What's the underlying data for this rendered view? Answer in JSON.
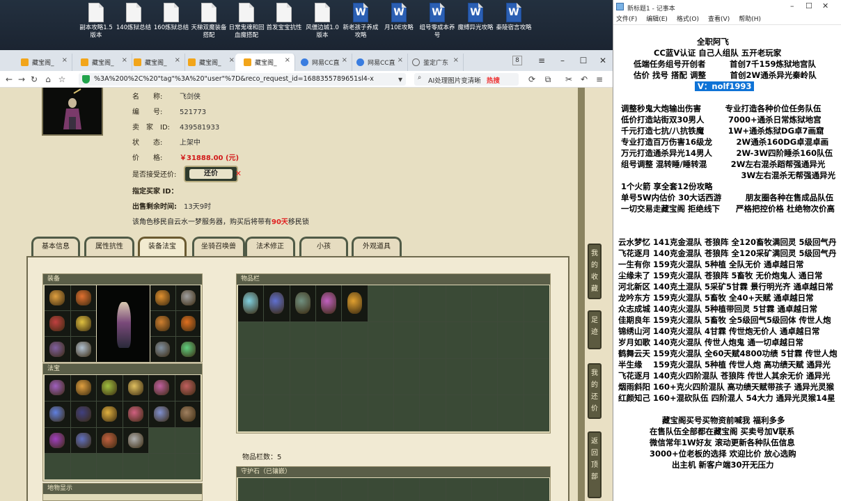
{
  "desktop": {
    "icons": [
      {
        "label": "副本攻略1.5版本",
        "type": "doc"
      },
      {
        "label": "140炼狱总结",
        "type": "doc"
      },
      {
        "label": "160炼狱总结",
        "type": "doc"
      },
      {
        "label": "天梯双魔装备搭配",
        "type": "doc"
      },
      {
        "label": "日常鬼魂和回血魔搭配",
        "type": "doc"
      },
      {
        "label": "首发宝宝抗性",
        "type": "doc"
      },
      {
        "label": "风僵边城1.0版本",
        "type": "doc"
      },
      {
        "label": "新老孩子养成攻略",
        "type": "word"
      },
      {
        "label": "月10E攻略",
        "type": "word"
      },
      {
        "label": "组号零成本养号",
        "type": "word"
      },
      {
        "label": "魔缚异光攻略",
        "type": "word"
      },
      {
        "label": "秦陵宿言攻略",
        "type": "word"
      }
    ]
  },
  "browser": {
    "tabs": [
      {
        "label": "藏宝阁_",
        "icon": "treasure"
      },
      {
        "label": "藏宝阁_",
        "icon": "treasure"
      },
      {
        "label": "藏宝阁_",
        "icon": "treasure"
      },
      {
        "label": "藏宝阁_",
        "icon": "treasure"
      },
      {
        "label": "藏宝阁_",
        "icon": "treasure",
        "active": true
      },
      {
        "label": "网易CC直",
        "icon": "cc"
      },
      {
        "label": "网易CC直",
        "icon": "cc"
      },
      {
        "label": "鉴定广东",
        "icon": "globe"
      }
    ],
    "tab_count_badge": "8",
    "url": "%3A%200%2C%20\"tag\"%3A%20\"user\"%7D&reco_request_id=1688355789651sl4-x",
    "search_text": "AI处理图片变清晰",
    "search_hot": "热搜"
  },
  "character": {
    "rows": [
      {
        "label": "名　　称:",
        "value": "飞剑侠"
      },
      {
        "label": "编　　号:",
        "value": "521773"
      },
      {
        "label": "卖　家　ID:",
        "value": "439581933"
      },
      {
        "label": "状　　态:",
        "value": "上架中"
      },
      {
        "label": "价　　格:",
        "value": "￥31888.00 (元)"
      }
    ],
    "bargain_question": "是否接受还价:",
    "bargain_button": "还价",
    "buyer_id_label": "指定买家 ID：",
    "time_left_label": "出售剩余时间:",
    "time_left_value": "13天9时",
    "notice_prefix": "该角色移民自云水一梦服务器，购买后将带有",
    "notice_days": "90天",
    "notice_suffix": "移民锁"
  },
  "tabs": [
    {
      "label": "基本信息"
    },
    {
      "label": "属性抗性"
    },
    {
      "label": "装备法宝",
      "active": true
    },
    {
      "label": "坐骑召唤兽"
    },
    {
      "label": "法术修正"
    },
    {
      "label": "小孩"
    },
    {
      "label": "外观道具"
    }
  ],
  "sections": {
    "equipment": "装备",
    "fabao": "法宝",
    "items": "物品栏",
    "items_count": "物品栏数：5",
    "guard": "守护石（已镶嵌）",
    "bottom": "地物显示"
  },
  "float_buttons": [
    {
      "label": "我的收藏"
    },
    {
      "label": "足迹"
    },
    {
      "label": "我的还价"
    },
    {
      "label": "返回顶部"
    }
  ],
  "notepad": {
    "title": "新标题1 - 记事本",
    "menu": [
      "文件(F)",
      "编辑(E)",
      "格式(O)",
      "查看(V)",
      "帮助(H)"
    ],
    "lines_top": [
      "全职阿飞",
      "CC蓝V认证 自己人组队 五开老玩家",
      "低端任务组号开创者　　　首创7千159炼狱地宫队",
      "估价 找号 搭配 调整　　　首创2W通杀异光秦岭队"
    ],
    "contact": "V：nolf1993",
    "block1": [
      "调整秒鬼大炮输出伤害　　　专业打造各种价位任务队伍",
      "低价打造站街双30男人　　　7000+通杀日常炼狱地宫",
      "千元打造七抗/八抗铁魔　　　1W+通杀炼狱DG卓7画窟",
      "专业打造百万伤害16级龙　　　2W通杀160DG卓混卓画",
      "万元打造通杀异光14男人　　　2W-3W四阶睡杀160队伍",
      "组号调整 混转睡/睡转混　　　2W左右混杀蹈帮强通异光",
      "　　　　　　　　　　　　　　　3W左右混杀无帮强通异光"
    ],
    "block2": [
      "1个火箭 享全套12份攻略",
      "单号5W内估价 30大话西游　　　朋友圈各种在售成品队伍",
      "一切交易走藏宝阁 拒绝线下　　严格把控价格 杜绝物次价高"
    ],
    "block3": [
      "云水梦忆 141克金混队 苍狼阵 全120畜牧满回灵 5级回气丹",
      "飞花逐月 140克金混队 苍狼阵 全120采矿满回灵 5级回气丹",
      "一生有你 159克火混队 5种植 全队无价 通卓越日常",
      "尘缘未了 159克火混队 苍狼阵 5畜牧 无价炮鬼人 通日常",
      "河北新区 140克土混队 5采矿5甘霖 景行明光齐 通卓越日常",
      "龙吟东方 159克火混队 5畜牧 全40+天赋 通卓越日常",
      "众志成城 140克火混队 5种植带回灵 5甘霖 通卓越日常",
      "佳期良年 159克火混队 5畜牧 全5级回气5级回体 传世人炮",
      "锦绣山河 140克火混队 4甘霖 传世炮无价人 通卓越日常",
      "岁月如歌 140克火混队 传世人炮鬼 通一切卓越日常",
      "鹤舞云天 159克火混队 全60天赋4800功绩 5甘霖 传世人炮",
      "半生缘　 159克火混队 5种植 传世人炮 高功绩天赋 通异光",
      "飞花逐月 140克火四阶混队 苍狼阵 传世人其余无价 通异光",
      "烟雨斜阳 160+克火四阶混队 高功绩天赋带孩子 通异光灵猴",
      "红颜知己 160+混砍队伍 四阶混人 54大力 通异光灵猴14星"
    ],
    "block4": [
      "藏宝阁买号买物资前喊我 福利多多",
      "在售队伍全部都在藏宝阁 买卖号加V联系",
      "微信常年1W好友 滚动更新各种队伍信息",
      "3000+位老板的选择 欢迎比价 放心选购",
      "出主机 新客户端30开无压力"
    ]
  },
  "colors": {
    "price_red": "#d21a1a",
    "selection_blue": "#0f73d6",
    "game_bg": "#e7dfc2",
    "section_header": "#5a5e48"
  }
}
